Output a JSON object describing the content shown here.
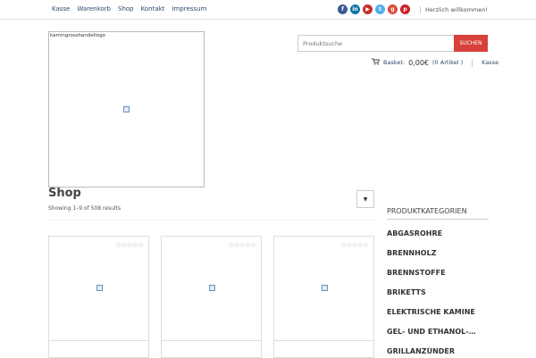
{
  "topnav": [
    "Kasse",
    "Warenkorb",
    "Shop",
    "Kontakt",
    "Impressum"
  ],
  "social": [
    {
      "name": "facebook-icon",
      "glyph": "f",
      "color": "#3b5998"
    },
    {
      "name": "linkedin-icon",
      "glyph": "in",
      "color": "#0e76a8"
    },
    {
      "name": "youtube-icon",
      "glyph": "▶",
      "color": "#c4302b"
    },
    {
      "name": "twitter-icon",
      "glyph": "t",
      "color": "#55acee"
    },
    {
      "name": "googleplus-icon",
      "glyph": "g",
      "color": "#dd4b39"
    },
    {
      "name": "pinterest-icon",
      "glyph": "p",
      "color": "#cb2027"
    }
  ],
  "welcome": "Herzlich willkommen!",
  "logo_alt": "kamingrosshandellogo",
  "search": {
    "placeholder": "Produktsuche",
    "button": "SUCHEN"
  },
  "basket": {
    "label": "Basket:",
    "amount": "0,00€",
    "count": "(0 Artikel )",
    "checkout": "Kasse"
  },
  "shop": {
    "title": "Shop",
    "results": "Showing 1–9 of 508 results"
  },
  "sidebar": {
    "title": "PRODUKTKATEGORIEN",
    "categories": [
      "ABGASROHRE",
      "BRENNHOLZ",
      "BRENNSTOFFE",
      "BRIKETTS",
      "ELEKTRISCHE KAMINE",
      "GEL- UND ETHANOL-KAMINE",
      "GRILLANZÜNDER"
    ]
  },
  "product_rating": "☆☆☆☆☆"
}
